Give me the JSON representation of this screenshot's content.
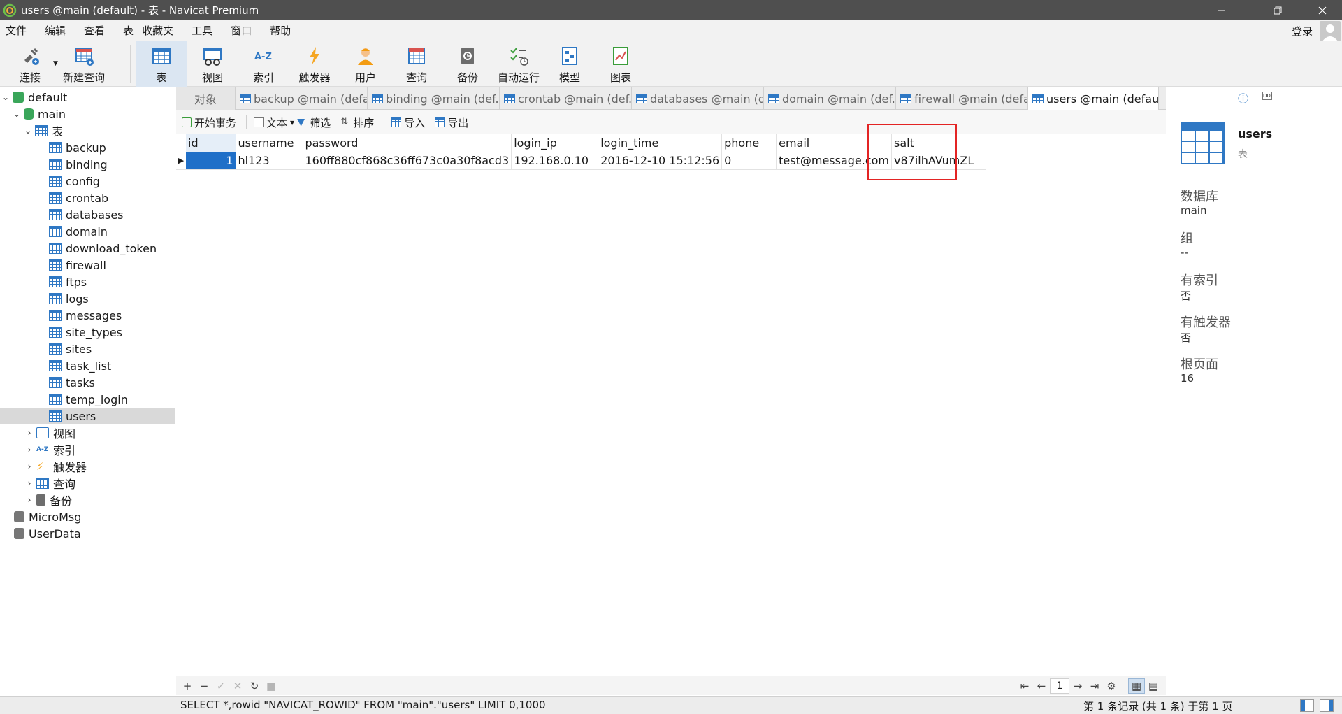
{
  "window": {
    "title": "users @main (default) - 表 - Navicat Premium"
  },
  "menubar": {
    "items": [
      "文件",
      "编辑",
      "查看",
      "表",
      "收藏夹",
      "工具",
      "窗口",
      "帮助"
    ],
    "login": "登录"
  },
  "toolbar": {
    "buttons": [
      {
        "label": "连接",
        "icon": "connect-plug-icon"
      },
      {
        "label": "新建查询",
        "icon": "new-query-icon"
      },
      {
        "label": "表",
        "icon": "table-icon",
        "active": true
      },
      {
        "label": "视图",
        "icon": "view-icon"
      },
      {
        "label": "索引",
        "icon": "index-az-icon"
      },
      {
        "label": "触发器",
        "icon": "trigger-bolt-icon"
      },
      {
        "label": "用户",
        "icon": "user-icon"
      },
      {
        "label": "查询",
        "icon": "query-icon"
      },
      {
        "label": "备份",
        "icon": "backup-icon"
      },
      {
        "label": "自动运行",
        "icon": "automation-icon"
      },
      {
        "label": "模型",
        "icon": "model-icon"
      },
      {
        "label": "图表",
        "icon": "chart-icon"
      }
    ]
  },
  "tree": {
    "connection": "default",
    "database": "main",
    "tables_group": "表",
    "tables": [
      "backup",
      "binding",
      "config",
      "crontab",
      "databases",
      "domain",
      "download_token",
      "firewall",
      "ftps",
      "logs",
      "messages",
      "site_types",
      "sites",
      "task_list",
      "tasks",
      "temp_login",
      "users"
    ],
    "selected_table": "users",
    "groups": [
      "视图",
      "索引",
      "触发器",
      "查询",
      "备份"
    ],
    "other_connections": [
      "MicroMsg",
      "UserData"
    ]
  },
  "tabs": [
    {
      "label": "对象"
    },
    {
      "label": "backup @main (defa..."
    },
    {
      "label": "binding @main (def..."
    },
    {
      "label": "crontab @main (def..."
    },
    {
      "label": "databases @main (d..."
    },
    {
      "label": "domain @main (def..."
    },
    {
      "label": "firewall @main (defa..."
    },
    {
      "label": "users @main (defaul..."
    }
  ],
  "data_toolbar": {
    "begin_transaction": "开始事务",
    "text": "文本",
    "filter": "筛选",
    "sort": "排序",
    "import": "导入",
    "export": "导出"
  },
  "grid": {
    "columns": [
      "id",
      "username",
      "password",
      "login_ip",
      "login_time",
      "phone",
      "email",
      "salt"
    ],
    "rows": [
      [
        "1",
        "hl123",
        "160ff880cf868c36ff673c0a30f8acd3",
        "192.168.0.10",
        "2016-12-10 15:12:56",
        "0",
        "test@message.com",
        "v87ilhAVumZL"
      ]
    ],
    "page": "1"
  },
  "statusbar": {
    "sql": "SELECT *,rowid \"NAVICAT_ROWID\" FROM \"main\".\"users\" LIMIT 0,1000",
    "records": "第 1 条记录 (共 1 条) 于第 1 页"
  },
  "info": {
    "name": "users",
    "type": "表",
    "props": [
      {
        "label": "数据库",
        "value": "main"
      },
      {
        "label": "组",
        "value": "--"
      },
      {
        "label": "有索引",
        "value": "否"
      },
      {
        "label": "有触发器",
        "value": "否"
      },
      {
        "label": "根页面",
        "value": "16"
      }
    ]
  },
  "colors": {
    "accent": "#1f6fc8",
    "highlight": "#e32424",
    "titlebar": "#4f4f4f"
  }
}
